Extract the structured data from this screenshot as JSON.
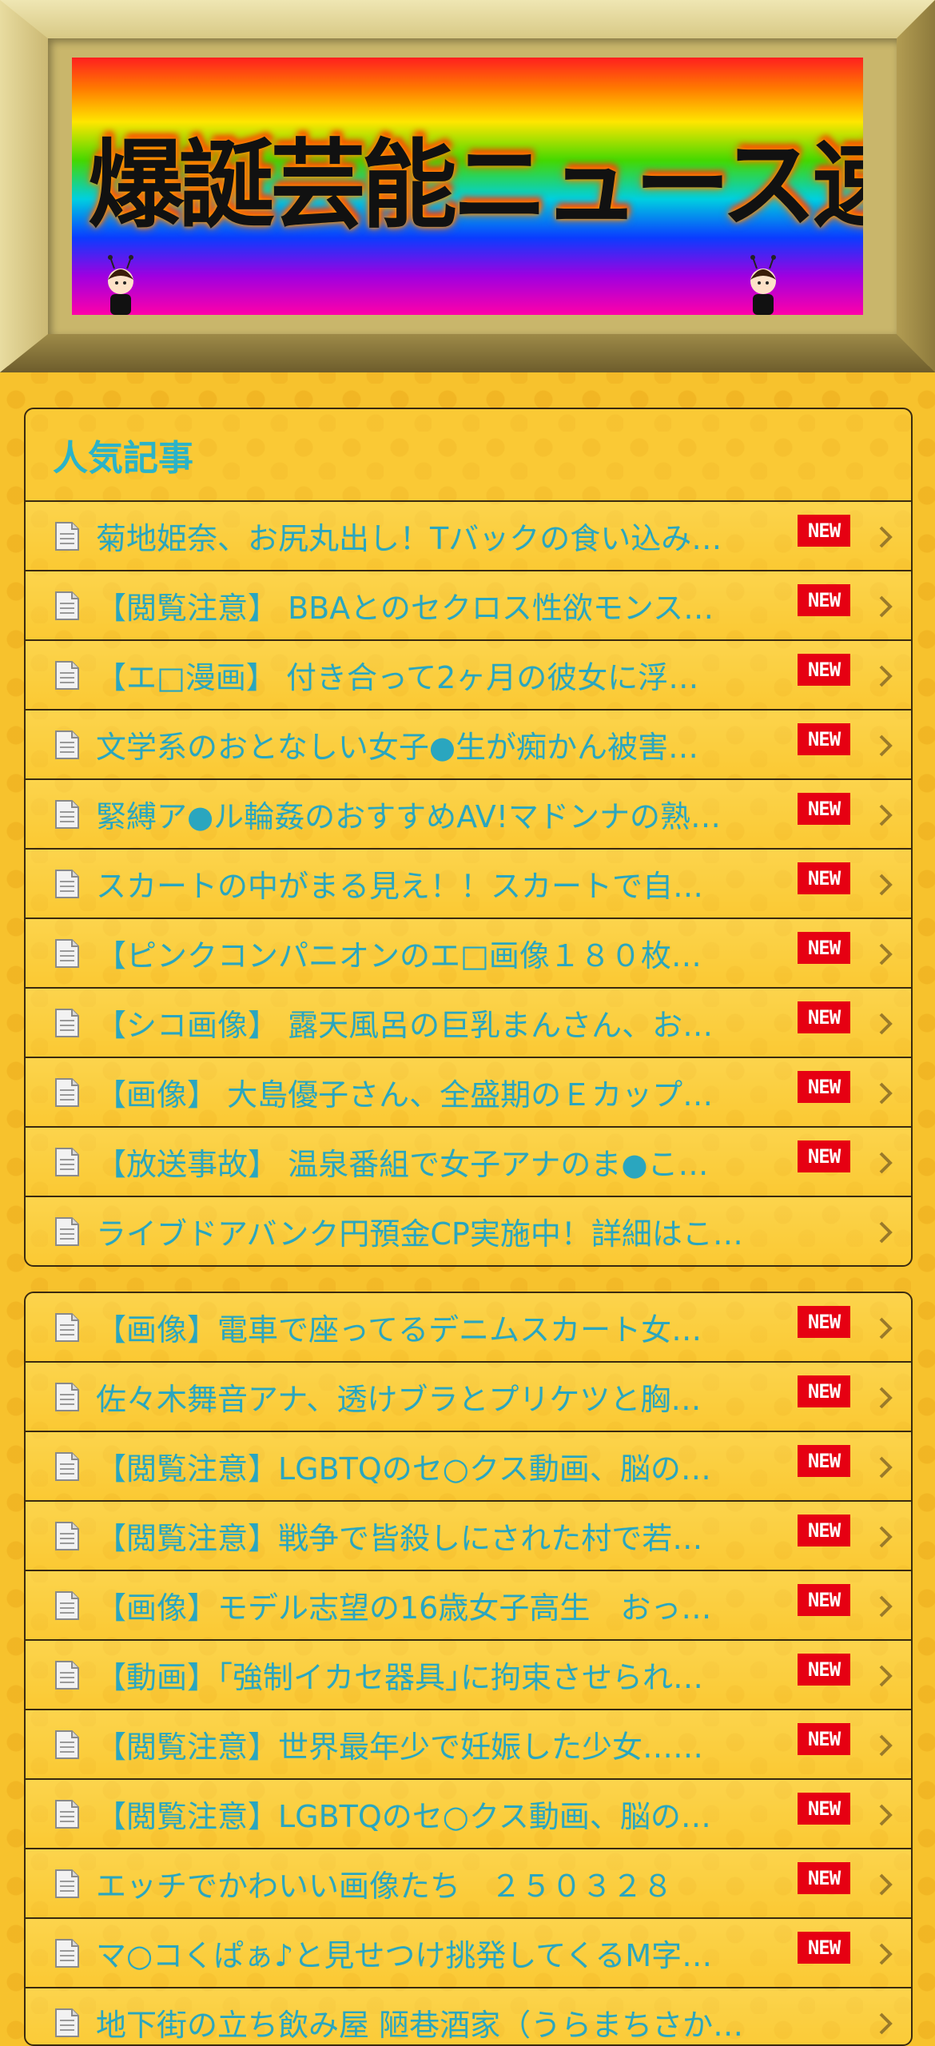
{
  "site": {
    "title": "爆誕芸能ニュース速報"
  },
  "popular": {
    "heading": "人気記事",
    "badge_label": "NEW",
    "items": [
      {
        "title": "菊地姫奈、お尻丸出し！Tバックの食い込み…",
        "is_new": true
      },
      {
        "title": "【閲覧注意】 BBAとのセクロス性欲モンス…",
        "is_new": true
      },
      {
        "title": "【エ□漫画】 付き合って2ヶ月の彼女に浮…",
        "is_new": true
      },
      {
        "title": "文学系のおとなしい女子●生が痴かん被害…",
        "is_new": true
      },
      {
        "title": "緊縛ア●ル輪姦のおすすめAV!マドンナの熟…",
        "is_new": true
      },
      {
        "title": "スカートの中がまる見え！！スカートで自…",
        "is_new": true
      },
      {
        "title": "【ピンクコンパニオンのエ□画像１８０枚…",
        "is_new": true
      },
      {
        "title": "【シコ画像】 露天風呂の巨乳まんさん、お…",
        "is_new": true
      },
      {
        "title": "【画像】 大島優子さん、全盛期のＥカップ…",
        "is_new": true
      },
      {
        "title": "【放送事故】 温泉番組で女子アナのま●こ…",
        "is_new": true
      },
      {
        "title": "ライブドアバンク円預金CP実施中！詳細はこ…",
        "is_new": false
      }
    ]
  },
  "latest": {
    "items": [
      {
        "title": "【画像】電車で座ってるデニムスカート女…",
        "is_new": true
      },
      {
        "title": "佐々木舞音アナ、透けブラとプリケツと胸…",
        "is_new": true
      },
      {
        "title": "【閲覧注意】LGBTQのセ○クス動画、脳の…",
        "is_new": true
      },
      {
        "title": "【閲覧注意】戦争で皆殺しにされた村で若…",
        "is_new": true
      },
      {
        "title": "【画像】モデル志望の16歳女子高生　おっ…",
        "is_new": true
      },
      {
        "title": "【動画】｢強制イカセ器具｣に拘束させられ…",
        "is_new": true
      },
      {
        "title": "【閲覧注意】世界最年少で妊娠した少女……",
        "is_new": true
      },
      {
        "title": "【閲覧注意】LGBTQのセ○クス動画、脳の…",
        "is_new": true
      },
      {
        "title": "エッチでかわいい画像たち　２５０３２８",
        "is_new": true
      },
      {
        "title": "マ○コくぱぁ♪と見せつけ挑発してくるM字…",
        "is_new": true
      },
      {
        "title": "地下街の立ち飲み屋 陋巷酒家（うらまちさか…",
        "is_new": false
      }
    ]
  }
}
